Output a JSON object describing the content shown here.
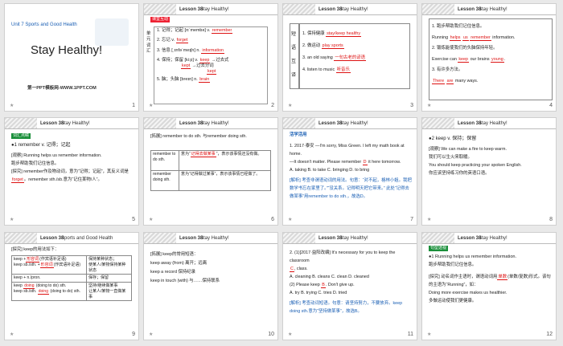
{
  "common": {
    "lesson": "Lesson 38",
    "title": "Stay Healthy!",
    "title2": "Sports and Good Health"
  },
  "s1": {
    "unit": "Unit 7  Sports and Good Health",
    "title": "Stay Healthy!",
    "site": "第一PPT模板网-WWW.1PPT.COM",
    "num": "1"
  },
  "s2": {
    "badge": "课堂互动",
    "side": "单元词汇",
    "lines": [
      {
        "pre": "1. 记得；记起 [rɪˈmembə] v.",
        "ans": "remember"
      },
      {
        "pre": "2. 忘记 v.",
        "ans": "forget"
      },
      {
        "pre": "3. 信息 [ˌɪnfəˈmeɪʃn] n.",
        "ans": "information"
      },
      {
        "pre": "4. 保持；保留 [kiːp] v.",
        "ans": "keep",
        "post": "→过去式"
      },
      {
        "pre": "",
        "ans": "kept",
        "post": "→过去分词"
      },
      {
        "pre": "",
        "ans": "kept"
      },
      {
        "pre": "5. 脑；头脑 [breɪn] n.",
        "ans": "brain"
      }
    ],
    "num": "2"
  },
  "s3": {
    "side": [
      "短",
      "语",
      "互",
      "译"
    ],
    "lines": [
      {
        "pre": "1. 保持健康",
        "ans": "stay/keep healthy"
      },
      {
        "pre": "2. 做运动",
        "ans": "play sports"
      },
      {
        "pre": "3. an old saying",
        "ans": "一句古老的谚语"
      },
      {
        "pre": "4. listen to music",
        "ans": "听音乐"
      }
    ],
    "num": "3"
  },
  "s4": {
    "lines": [
      {
        "t": "1. 跑步帮助我们记住信息。"
      },
      {
        "t": "Running",
        "a1": "helps",
        "a2": "us",
        "a3": "remember",
        "post": "information."
      },
      {
        "t": "2. 锻炼能使我们的头脑保持年轻。"
      },
      {
        "t": "Exercise can",
        "a1": "keep",
        "mid": "our brains",
        "a2": "young",
        "post": "."
      },
      {
        "t": "3. 有许多方法。"
      },
      {
        "t": "",
        "a1": "There",
        "a2": "are",
        "post": "many ways."
      }
    ],
    "num": "4"
  },
  "s5": {
    "badge": "词汇点睛",
    "head": "●1   remember v. 记得；记起",
    "lines": [
      "[观察] Running helps us remember information.",
      "跑步帮助我们记住信息。",
      "[探究] remember作及物动词，意为“记得；记起”，其反义词是",
      "forget",
      "。remember sth./sb.意为“记住某物/人”。"
    ],
    "num": "5"
  },
  "s6": {
    "top": "[拓展] remember to do sth. 与remember doing sth.",
    "rows": [
      {
        "k": "remember to do sth.",
        "v1": "意为“",
        "ans": "记得去做某事",
        "v2": "”，表示该事情还没有做。"
      },
      {
        "k": "remember doing sth.",
        "v1": "意为“记得做过某事”，表示该事情已经做了。",
        "ans": "",
        "v2": ""
      }
    ],
    "num": "6"
  },
  "s7": {
    "badge": "活学活用",
    "q": "1. 2017·泰安 —I'm sorry, Miss Green. I left my math book at home.",
    "q2": "—It doesn't matter. Please remember",
    "ans": "D",
    "q3": "it here tomorrow.",
    "opts": "A. taking      B. to take      C. bringing      D. to bring",
    "analysis": "[解析] 考查非谓语动词的用法。句意：“对不起，格林小姐。我把数学书忘在家里了。”“没关系。记得明天把它带来。” 此处“记得去做某事”用remember to do sth.，故选D。",
    "num": "7"
  },
  "s8": {
    "head": "●2   keep v. 保持；保留",
    "lines": [
      "[观察] We can make a fire to keep warm.",
      "我们可以生火来取暖。",
      "You should keep practicing your spoken English.",
      "你应该坚持练习你的英语口语。"
    ],
    "num": "8"
  },
  "s9": {
    "top": "[探究] keep的用法如下：",
    "rows": [
      {
        "k": "keep +",
        "a": "形容词",
        "k2": "(作宾语补足语)",
        "v": "保持某种状态；"
      },
      {
        "k": "keep sb./sth. +",
        "a": "形容词",
        "k2": "(作宾语补足语)",
        "v": "使某人/某物保持某种状态"
      },
      {
        "k": "keep + n./pron.",
        "a": "",
        "k2": "",
        "v": "保存；保留"
      },
      {
        "k": "keep",
        "a": "doing",
        "k2": "(doing to do) sth.",
        "v": "坚持/继续做某事"
      },
      {
        "k": "keep sb./sth.",
        "a": "doing",
        "k2": "(doing to do) sth.",
        "v": "让某人/某物一直做某事"
      }
    ],
    "num": "9"
  },
  "s10": {
    "lines": [
      "[拓展] keep的常用短语：",
      "keep away (from) 离开；远离",
      "keep a record 保持纪录",
      "keep in touch (with) 与……保持联系"
    ],
    "num": "10"
  },
  "s11": {
    "q": "2. (1)[2017·益阳改编] It's necessary for you to keep the classroom",
    "ans1": "C",
    "q2": ", class.",
    "opts1": "A. cleaning     B. cleans     C. clean     D. cleaned",
    "q3": "(2) Please keep",
    "ans2": "B",
    "q4": ". Don't give up.",
    "opts2": "A. try     B. trying     C. tries     D. tried",
    "analysis": "[解析] 考查动词短语。句意：请坚持努力，不要放弃。keep doing sth.意为“坚持做某事”，故选B。",
    "num": "11"
  },
  "s12": {
    "badge": "句型透视",
    "head": "●1   Running helps us remember information.",
    "sub": "跑步帮助我们记住信息。",
    "lines": [
      "[探究] 动名词作主语时，谓语动词用",
      "单数",
      "(单数/复数)形式。该句的主语为“Running”，如：",
      "Doing more exercise makes us healthier.",
      "多做运动使我们更健康。"
    ],
    "num": "12"
  }
}
